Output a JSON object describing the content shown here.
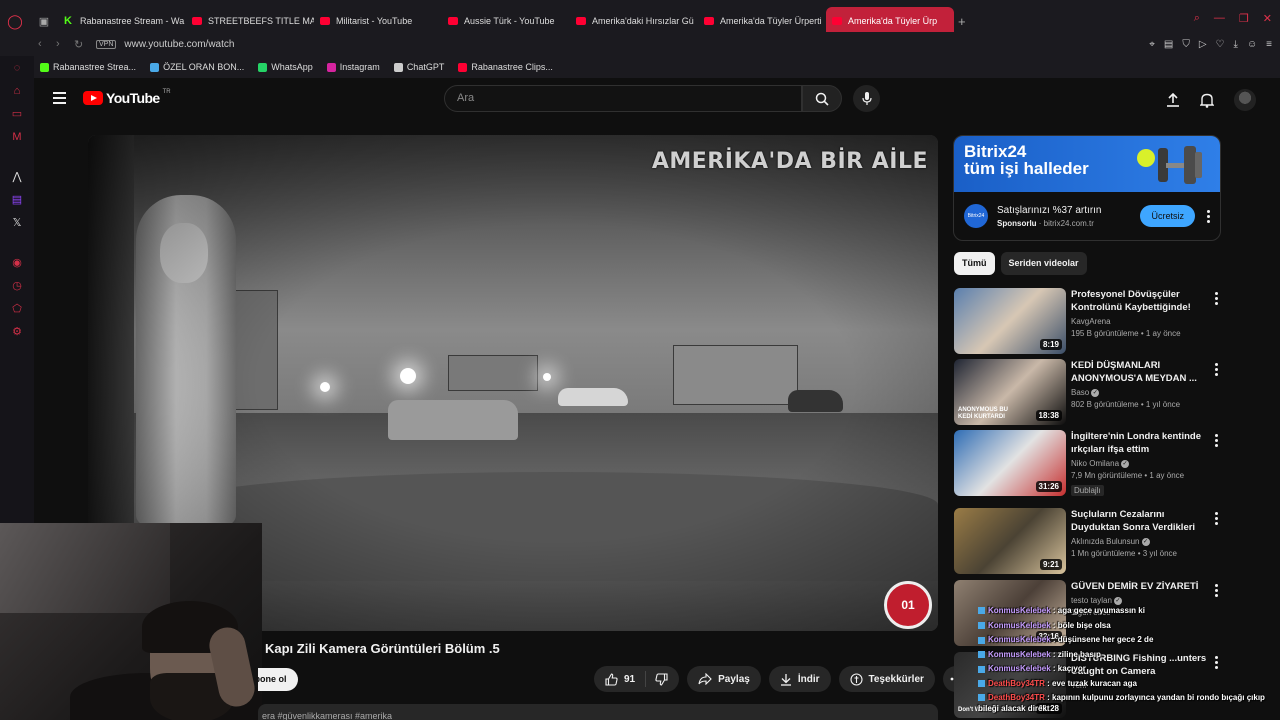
{
  "browser": {
    "tabs": [
      {
        "label": "Rabanastree Stream - Wa",
        "favicon": "kick",
        "active": false
      },
      {
        "label": "STREETBEEFS TITLE MA",
        "favicon": "youtube",
        "active": false
      },
      {
        "label": "Militarist - YouTube",
        "favicon": "youtube",
        "active": false
      },
      {
        "label": "Aussie Türk - YouTube",
        "favicon": "youtube",
        "active": false
      },
      {
        "label": "Amerika'daki Hırsızlar Gü",
        "favicon": "youtube",
        "active": false
      },
      {
        "label": "Amerika'da Tüyler Ürperti",
        "favicon": "youtube",
        "active": false
      },
      {
        "label": "Amerika'da Tüyler Ürp",
        "favicon": "youtube",
        "active": true
      }
    ],
    "address": {
      "vpn_label": "VPN",
      "url": "www.youtube.com/watch"
    },
    "bookmarks": [
      {
        "label": "Rabanastree Strea...",
        "color": "#53fc18"
      },
      {
        "label": "ÖZEL ORAN BON...",
        "color": "#4aa9e8"
      },
      {
        "label": "WhatsApp",
        "color": "#25d366"
      },
      {
        "label": "Instagram",
        "color": "#d6249f"
      },
      {
        "label": "ChatGPT",
        "color": "#cccccc"
      },
      {
        "label": "Rabanastree Clips...",
        "color": "#ff0033"
      }
    ]
  },
  "youtube": {
    "logo_text": "YouTube",
    "logo_region": "TR",
    "search_placeholder": "Ara"
  },
  "video": {
    "overlay_title": "AMERİKA'DA BİR AİLE",
    "title": "Kapı Zili Kamera Görüntüleri Bölüm .5",
    "subscribe_label": "Abone ol",
    "likes": "91",
    "share_label": "Paylaş",
    "download_label": "İndir",
    "thanks_label": "Teşekkürler",
    "description_snippet": "era #güvenlikkamerası #amerika"
  },
  "ad": {
    "brand": "Bitrix24",
    "slogan": "tüm işi halleder",
    "headline": "Satışlarınızı %37 artırın",
    "sponsored_label": "Sponsorlu",
    "domain": "bitrix24.com.tr",
    "cta": "Ücretsiz",
    "logo_text": "Bitrix24"
  },
  "chips": [
    {
      "label": "Tümü",
      "active": true
    },
    {
      "label": "Seriden videolar",
      "active": false
    }
  ],
  "recommendations": [
    {
      "title": "Profesyonel Dövüşçüler Kontrolünü Kaybettiğinde!",
      "channel": "KavgArena",
      "verified": false,
      "views": "195 B görüntüleme",
      "age": "1 ay önce",
      "duration": "8:19",
      "badge": "",
      "thumb_colors": [
        "#5a7fae",
        "#d7c7b4",
        "#3b4e68"
      ]
    },
    {
      "title": "KEDİ DÜŞMANLARI ANONYMOUS'A MEYDAN ...",
      "channel": "Baso",
      "verified": true,
      "views": "802 B görüntüleme",
      "age": "1 yıl önce",
      "duration": "18:38",
      "badge": "",
      "thumb_text": "ANONYMOUS BU KEDİ KURTARDI",
      "thumb_colors": [
        "#1f2533",
        "#c9b8a8",
        "#0d0d0d"
      ]
    },
    {
      "title": "İngiltere'nin Londra kentinde ırkçıları ifşa ettim",
      "channel": "Niko Omilana",
      "verified": true,
      "views": "7,9 Mn görüntüleme",
      "age": "1 ay önce",
      "duration": "31:26",
      "badge": "Dublajlı",
      "thumb_colors": [
        "#2f6db5",
        "#e2e2e2",
        "#c62f2f"
      ]
    },
    {
      "title": "Suçluların Cezalarını Duyduktan Sonra Verdikleri İlginç Tepkiler",
      "channel": "Aklınızda Bulunsun",
      "verified": true,
      "views": "1 Mn görüntüleme",
      "age": "3 yıl önce",
      "duration": "9:21",
      "badge": "",
      "thumb_colors": [
        "#9a7c46",
        "#4b4334",
        "#d8c39c"
      ]
    },
    {
      "title": "GÜVEN DEMİR EV ZİYARETİ",
      "channel": "testo taylan",
      "verified": true,
      "views": "",
      "age": "1 gün önce",
      "duration": "32:16",
      "badge": "",
      "thumb_colors": [
        "#8f8071",
        "#4c4038",
        "#c9b59e"
      ]
    },
    {
      "title": "DISTURBING Fishing ...unters Caught on Camera",
      "channel": "",
      "verified": false,
      "views": "",
      "age": "Yeni",
      "duration": "31:28",
      "badge": "",
      "thumb_text": "Don't Watch",
      "thumb_colors": [
        "#2a2a2a",
        "#444",
        "#111"
      ]
    }
  ],
  "chat": [
    {
      "user": "KonmusKelebek",
      "message": "aga gece uyumassın ki",
      "color": "#c59cff"
    },
    {
      "user": "KonmusKelebek",
      "message": "böle bişe olsa",
      "color": "#c59cff"
    },
    {
      "user": "KonmusKelebek",
      "message": "düşünsene her gece 2 de",
      "color": "#c59cff"
    },
    {
      "user": "KonmusKelebek",
      "message": "ziline basıp",
      "color": "#c59cff"
    },
    {
      "user": "KonmusKelebek",
      "message": "kaçıyor",
      "color": "#c59cff"
    },
    {
      "user": "DeathBoy34TR",
      "message": "eve tuzak kuracan aga",
      "color": "#ff4d4d"
    },
    {
      "user": "DeathBoy34TR",
      "message": "kapının kulpunu zorlayınca yandan bi rondo bıçağı çıkıp bileği alacak direkt",
      "color": "#ff4d4d"
    }
  ]
}
